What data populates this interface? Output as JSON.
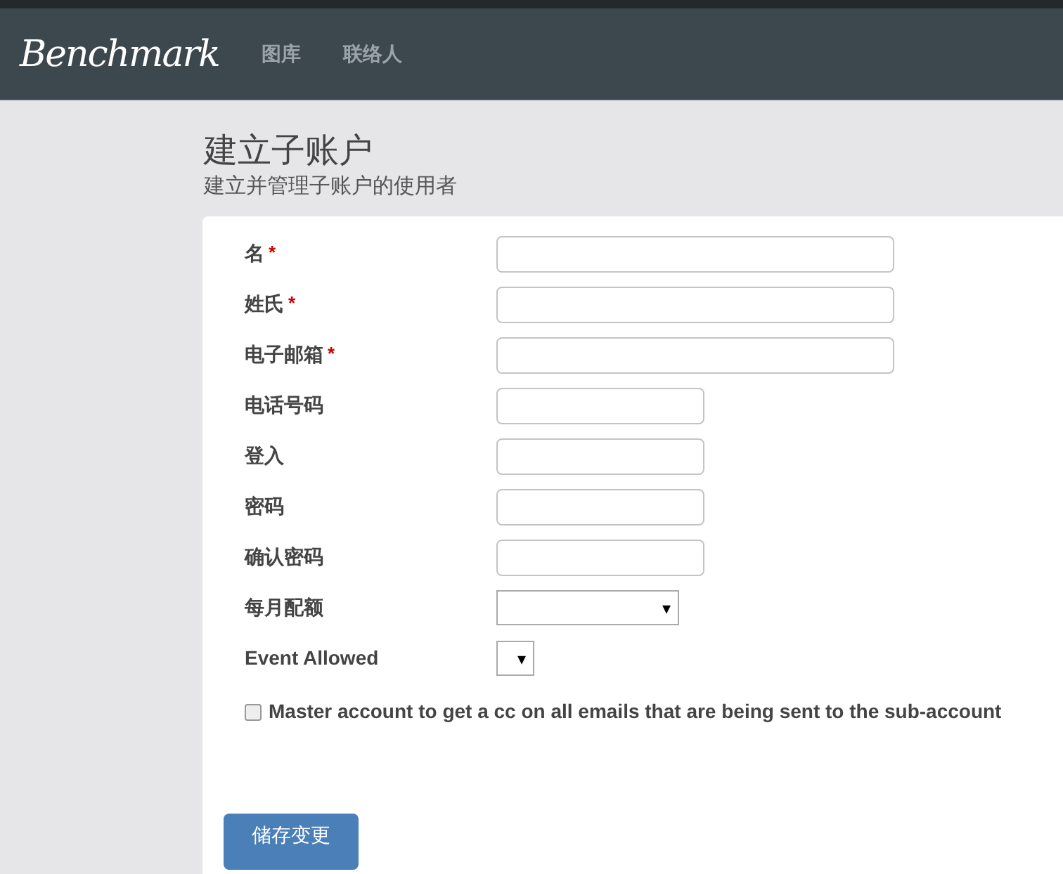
{
  "navbar": {
    "logo": "Benchmark",
    "links": [
      "图库",
      "联络人"
    ]
  },
  "header": {
    "title": "建立子账户",
    "subtitle": "建立并管理子账户的使用者"
  },
  "form": {
    "fields": [
      {
        "label": "名",
        "required_mark": "*",
        "kind": "text_long"
      },
      {
        "label": "姓氏",
        "required_mark": "*",
        "kind": "text_long"
      },
      {
        "label": "电子邮箱",
        "required_mark": "*",
        "kind": "text_long"
      },
      {
        "label": "电话号码",
        "kind": "text_short"
      },
      {
        "label": "登入",
        "kind": "text_short"
      },
      {
        "label": "密码",
        "kind": "text_short"
      },
      {
        "label": "确认密码",
        "kind": "text_short"
      },
      {
        "label": "每月配额",
        "kind": "select_wide",
        "caret": "▾"
      },
      {
        "label": "Event Allowed",
        "kind": "select_small",
        "caret": "▾"
      }
    ],
    "checkbox": {
      "label": "Master account to get a cc on all emails that are being sent to the sub-account",
      "checked": false
    },
    "save_button": "储存变更"
  }
}
